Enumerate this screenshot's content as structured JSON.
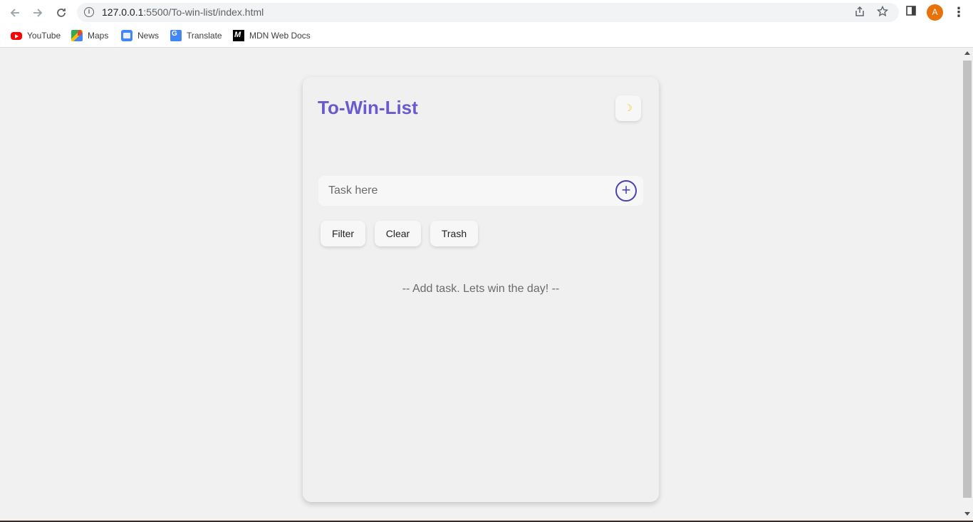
{
  "browser": {
    "url_host": "127.0.0.1",
    "url_path": ":5500/To-win-list/index.html",
    "avatar_letter": "A",
    "bookmarks": [
      {
        "label": "YouTube",
        "icon": "youtube-icon"
      },
      {
        "label": "Maps",
        "icon": "maps-icon"
      },
      {
        "label": "News",
        "icon": "news-icon"
      },
      {
        "label": "Translate",
        "icon": "translate-icon"
      },
      {
        "label": "MDN Web Docs",
        "icon": "mdn-icon"
      }
    ]
  },
  "app": {
    "title": "To-Win-List",
    "theme_icon": "☽",
    "input_placeholder": "Task here",
    "add_icon": "+",
    "buttons": {
      "filter": "Filter",
      "clear": "Clear",
      "trash": "Trash"
    },
    "empty_message": "-- Add task. Lets win the day! --",
    "accent_color": "#6a5acd"
  }
}
